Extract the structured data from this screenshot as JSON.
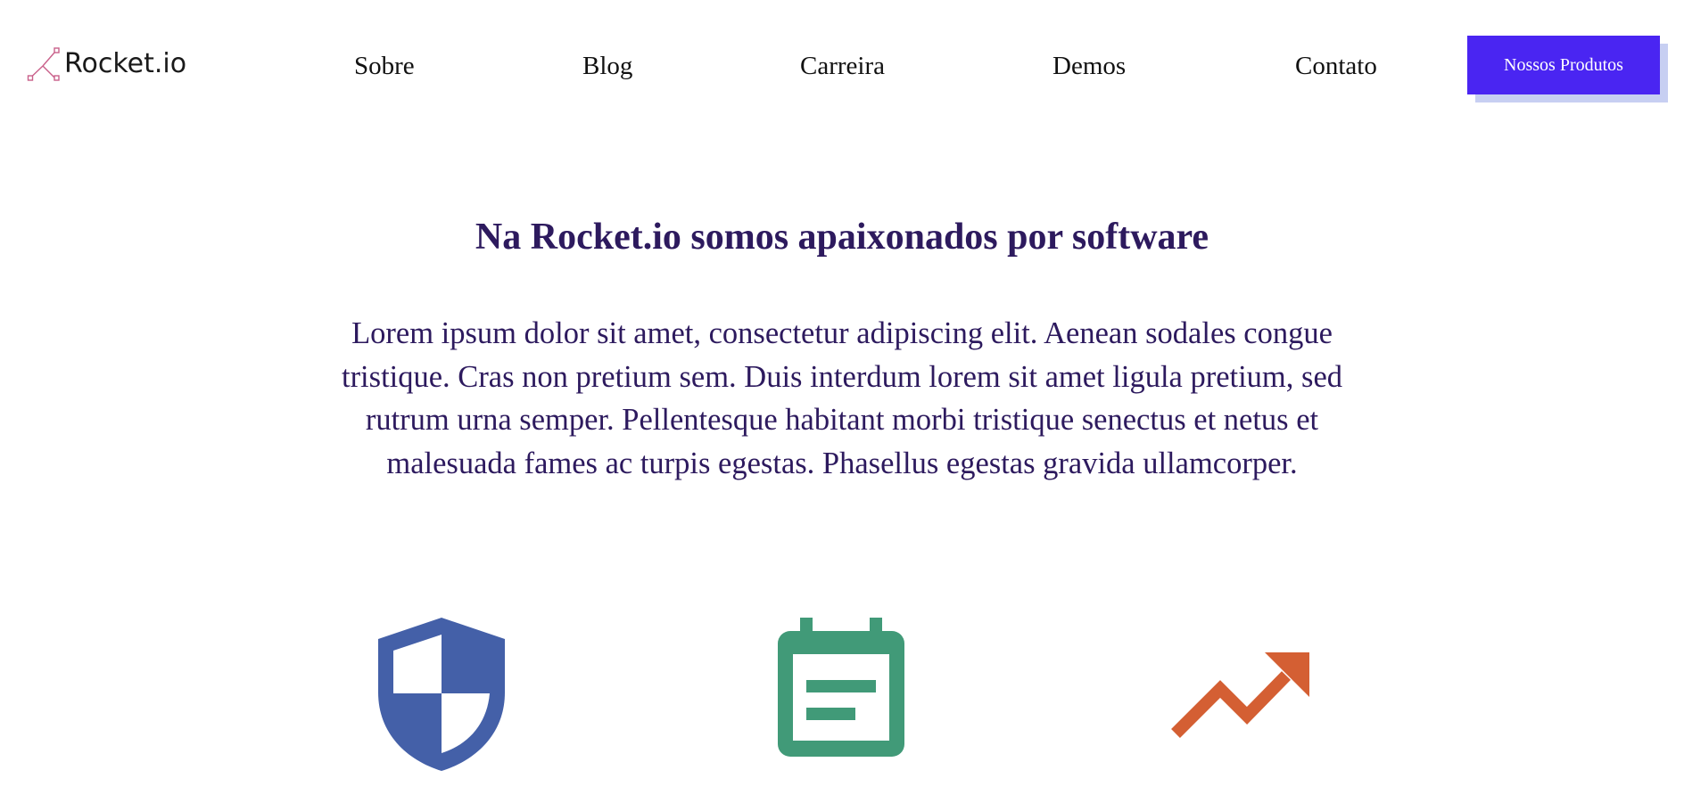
{
  "brand": {
    "name": "Rocket.io",
    "logo_icon": "rocket-trajectory-icon",
    "logo_color": "#c9608a"
  },
  "nav": {
    "items": [
      {
        "label": "Sobre"
      },
      {
        "label": "Blog"
      },
      {
        "label": "Carreira"
      },
      {
        "label": "Demos"
      },
      {
        "label": "Contato"
      }
    ],
    "cta_label": "Nossos Produtos",
    "cta_color": "#4a25f2"
  },
  "hero": {
    "title": "Na Rocket.io somos apaixonados por software",
    "body": "Lorem ipsum dolor sit amet, consectetur adipiscing elit. Aenean sodales congue tristique. Cras non pretium sem. Duis interdum lorem sit amet ligula pretium, sed rutrum urna semper. Pellentesque habitant morbi tristique senectus et netus et malesuada fames ac turpis egestas. Phasellus egestas gravida ullamcorper.",
    "text_color": "#2d1a5e"
  },
  "features": [
    {
      "icon": "shield-icon",
      "color": "#4460a8"
    },
    {
      "icon": "calendar-icon",
      "color": "#419a78"
    },
    {
      "icon": "trending-up-icon",
      "color": "#d45f33"
    }
  ]
}
